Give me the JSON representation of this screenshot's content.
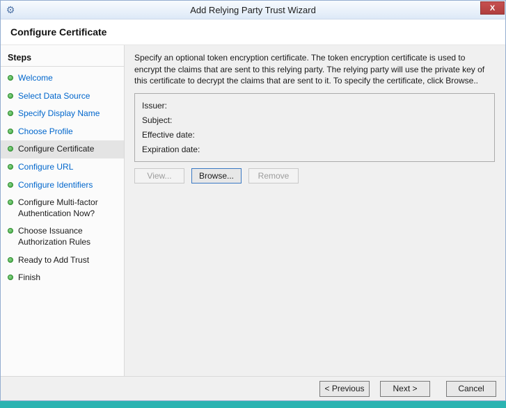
{
  "window": {
    "title": "Add Relying Party Trust Wizard",
    "close_glyph": "X",
    "app_icon_glyph": "⚙"
  },
  "header": {
    "title": "Configure Certificate"
  },
  "sidebar": {
    "title": "Steps",
    "items": [
      {
        "label": "Welcome",
        "state": "link"
      },
      {
        "label": "Select Data Source",
        "state": "link"
      },
      {
        "label": "Specify Display Name",
        "state": "link"
      },
      {
        "label": "Choose Profile",
        "state": "link"
      },
      {
        "label": "Configure Certificate",
        "state": "current"
      },
      {
        "label": "Configure URL",
        "state": "link"
      },
      {
        "label": "Configure Identifiers",
        "state": "link"
      },
      {
        "label": "Configure Multi-factor Authentication Now?",
        "state": "plain"
      },
      {
        "label": "Choose Issuance Authorization Rules",
        "state": "plain"
      },
      {
        "label": "Ready to Add Trust",
        "state": "plain"
      },
      {
        "label": "Finish",
        "state": "plain"
      }
    ]
  },
  "main": {
    "description": "Specify an optional token encryption certificate.  The token encryption certificate is used to encrypt the claims that are sent to this relying party.  The relying party will use the private key of this certificate to decrypt the claims that are sent to it.  To specify the certificate, click Browse..",
    "certificate_fields": [
      {
        "key": "issuer",
        "label": "Issuer:",
        "value": ""
      },
      {
        "key": "subject",
        "label": "Subject:",
        "value": ""
      },
      {
        "key": "effective-date",
        "label": "Effective date:",
        "value": ""
      },
      {
        "key": "expiration-date",
        "label": "Expiration date:",
        "value": ""
      }
    ],
    "buttons": [
      {
        "label": "View...",
        "enabled": false,
        "focused": false
      },
      {
        "label": "Browse...",
        "enabled": true,
        "focused": true
      },
      {
        "label": "Remove",
        "enabled": false,
        "focused": false
      }
    ]
  },
  "footer": {
    "buttons": [
      {
        "label": "< Previous"
      },
      {
        "label": "Next >"
      },
      {
        "label": "Cancel"
      }
    ]
  },
  "colors": {
    "link": "#0066cc",
    "step_done": "#3da53d",
    "titlebar_close": "#c75050",
    "focus_border": "#3a79c3",
    "desktop": "#2bb3b1"
  }
}
